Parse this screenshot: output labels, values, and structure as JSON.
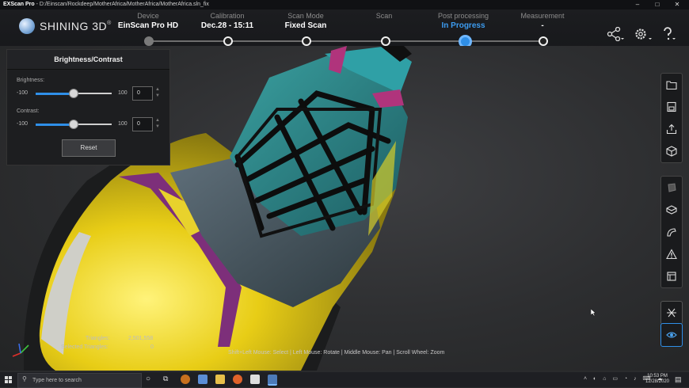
{
  "titlebar": {
    "app": "EXScan Pro",
    "path": " - D:/Einscan/Rockdeep/MotherAfrica/MotherAfrica/MotherAfrica.sln_fix"
  },
  "logo": {
    "text": "SHINING 3D",
    "mark": "®"
  },
  "steps": [
    {
      "label": "Device",
      "value": "EinScan Pro HD"
    },
    {
      "label": "Calibration",
      "value": "Dec.28 - 15:11"
    },
    {
      "label": "Scan Mode",
      "value": "Fixed Scan"
    },
    {
      "label": "Scan",
      "value": ""
    },
    {
      "label": "Post processing",
      "value": "In Progress"
    },
    {
      "label": "Measurement",
      "value": "-"
    }
  ],
  "panel": {
    "title": "Brightness/Contrast",
    "brightness_label": "Brightness:",
    "contrast_label": "Contrast:",
    "min": "-100",
    "max": "100",
    "brightness_value": "0",
    "contrast_value": "0",
    "brightness_level": 0.5,
    "contrast_level": 0.5,
    "reset_label": "Reset"
  },
  "stats": {
    "triangles_label": "Triangles:",
    "triangles_value": "2,501,558",
    "selected_label": "Selected Triangles:",
    "selected_value": "0"
  },
  "hint": "Shift+Left Mouse: Select | Left Mouse: Rotate | Middle Mouse: Pan | Scroll Wheel: Zoom",
  "taskbar": {
    "search_placeholder": "Type here to search",
    "time": "10:53 PM",
    "date": "12/28/2020"
  },
  "colors": {
    "accent": "#2f8fe8",
    "progress_active": "#3c9cf0"
  },
  "icons": [
    "share-icon",
    "gear-icon",
    "help-icon",
    "folder-icon",
    "save-icon",
    "export-icon",
    "cube-icon",
    "mask-icon",
    "plane-icon",
    "smooth-icon",
    "warning-icon",
    "box-icon",
    "mesh-icon",
    "eye-icon"
  ]
}
